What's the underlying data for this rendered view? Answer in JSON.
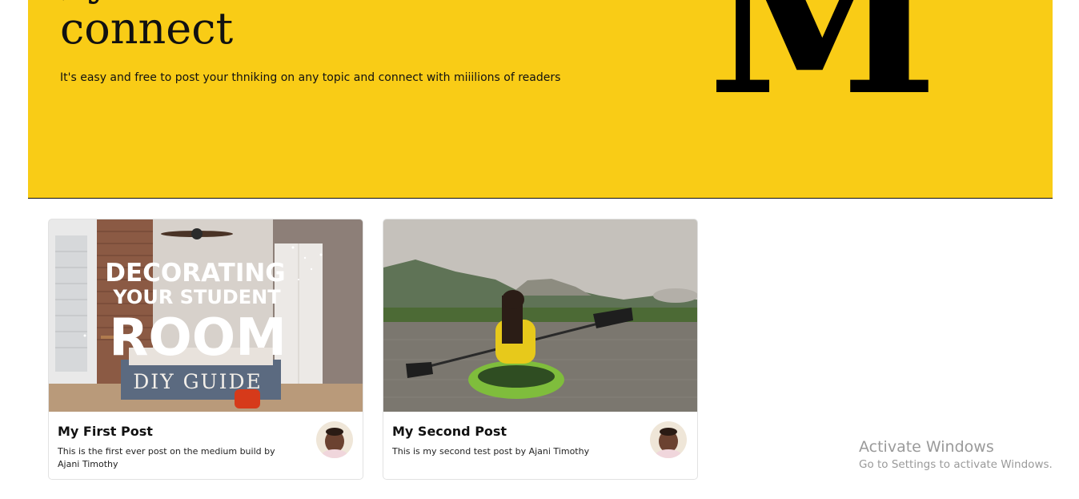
{
  "hero": {
    "title": "connect",
    "subtitle": "It's easy and free to post your thniking on any topic and connect with miiilions of readers",
    "logo_letter": "M",
    "background_color": "#f9cc16"
  },
  "posts": [
    {
      "title": "My First Post",
      "description": "This is the first ever post on the medium build by Ajani Timothy",
      "image_text": {
        "line1": "DECORATING",
        "line2": "YOUR STUDENT",
        "line3": "ROOM",
        "line4": "DIY GUIDE"
      }
    },
    {
      "title": "My Second Post",
      "description": "This is my second test post by Ajani Timothy"
    }
  ],
  "watermark": {
    "title": "Activate Windows",
    "subtitle": "Go to Settings to activate Windows."
  }
}
